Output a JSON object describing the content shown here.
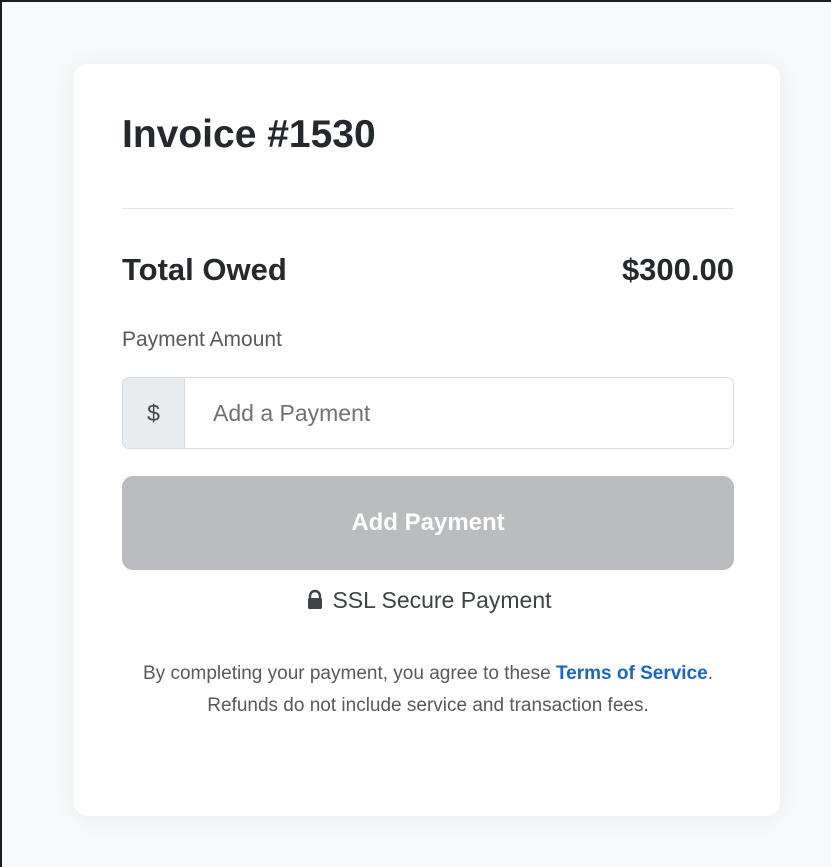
{
  "invoice": {
    "title": "Invoice #1530"
  },
  "summary": {
    "total_label": "Total Owed",
    "total_value": "$300.00"
  },
  "payment": {
    "label": "Payment Amount",
    "currency_symbol": "$",
    "placeholder": "Add a Payment",
    "button_label": "Add Payment",
    "secure_label": "SSL Secure Payment",
    "lock_icon": "lock-icon"
  },
  "terms": {
    "prefix": "By completing your payment, you agree to these ",
    "link_text": "Terms of Service",
    "suffix": ". Refunds do not include service and transaction fees."
  },
  "colors": {
    "page_background": "#f8f9fa",
    "card_background": "#ffffff",
    "text_primary": "#25282c",
    "text_secondary": "#555a60",
    "button_disabled": "#babcc0",
    "link": "#1a66c8",
    "input_addon": "#e9ecef",
    "border": "#d7dbe0"
  }
}
